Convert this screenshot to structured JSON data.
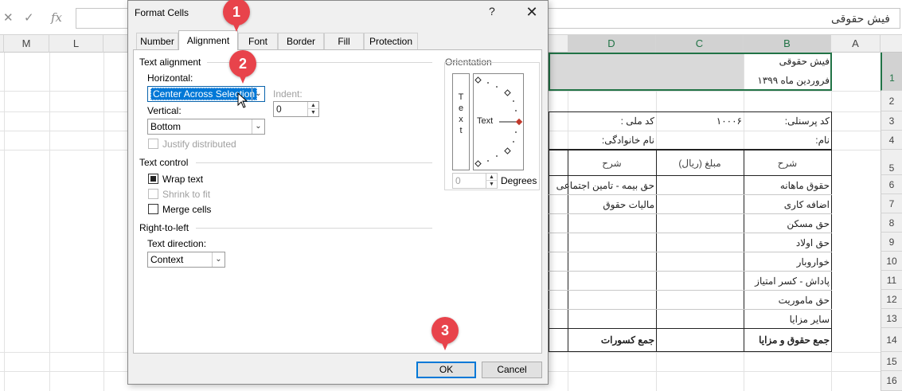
{
  "formula_bar": {
    "cancel_glyph": "✕",
    "enter_glyph": "✓",
    "fx_label": "fx",
    "content": "فیش حقوقی"
  },
  "columns": [
    "M",
    "L",
    "D",
    "C",
    "B",
    "A"
  ],
  "rows": [
    "1",
    "2",
    "3",
    "4",
    "5",
    "6",
    "7",
    "8",
    "9",
    "10",
    "11",
    "12",
    "13",
    "14",
    "15",
    "16"
  ],
  "sheet": {
    "b1_line1": "فیش حقوقی",
    "b1_line2": "فروردین ماه ۱۳۹۹",
    "code_personnel": "کد پرسنلی:",
    "code_personnel_value": "۱۰۰۰۶",
    "national_code": "کد ملی :",
    "name": "نام:",
    "family": "نام خانوادگی:",
    "hdr_desc_right": "شرح",
    "hdr_amount": "مبلغ (ریال)",
    "hdr_desc_left": "شرح",
    "items_right": [
      "حقوق ماهانه",
      "اضافه کاری",
      "حق مسکن",
      "حق اولاد",
      "خواروبار",
      "پاداش - کسر امتیاز",
      "حق ماموریت",
      "سایر مزایا"
    ],
    "items_left": [
      "حق بیمه - تامین اجتماعی",
      "مالیات حقوق"
    ],
    "total_right": "جمع حقوق و مزایا",
    "total_left": "جمع کسورات"
  },
  "dialog": {
    "title": "Format Cells",
    "help": "?",
    "close": "✕",
    "tabs": [
      "Number",
      "Alignment",
      "Font",
      "Border",
      "Fill",
      "Protection"
    ],
    "active_tab": "Alignment",
    "text_alignment": {
      "group_label": "Text alignment",
      "horizontal_label": "Horizontal:",
      "horizontal_value": "Center Across Selection",
      "indent_label": "Indent:",
      "indent_value": "0",
      "vertical_label": "Vertical:",
      "vertical_value": "Bottom",
      "justify_label": "Justify distributed"
    },
    "text_control": {
      "group_label": "Text control",
      "wrap_label": "Wrap text",
      "wrap_checked": true,
      "shrink_label": "Shrink to fit",
      "merge_label": "Merge cells"
    },
    "rtl": {
      "group_label": "Right-to-left",
      "direction_label": "Text direction:",
      "direction_value": "Context"
    },
    "orientation": {
      "group_label": "Orientation",
      "vertical_letters": [
        "T",
        "e",
        "x",
        "t"
      ],
      "dial_text": "Text",
      "degrees_value": "0",
      "degrees_label": "Degrees"
    },
    "ok_label": "OK",
    "cancel_label": "Cancel"
  },
  "badges": [
    "1",
    "2",
    "3"
  ],
  "colors": {
    "excel_green": "#217346",
    "selection_blue": "#0078d7",
    "badge_red": "#e8434b",
    "orientation_marker": "#c0392b"
  }
}
